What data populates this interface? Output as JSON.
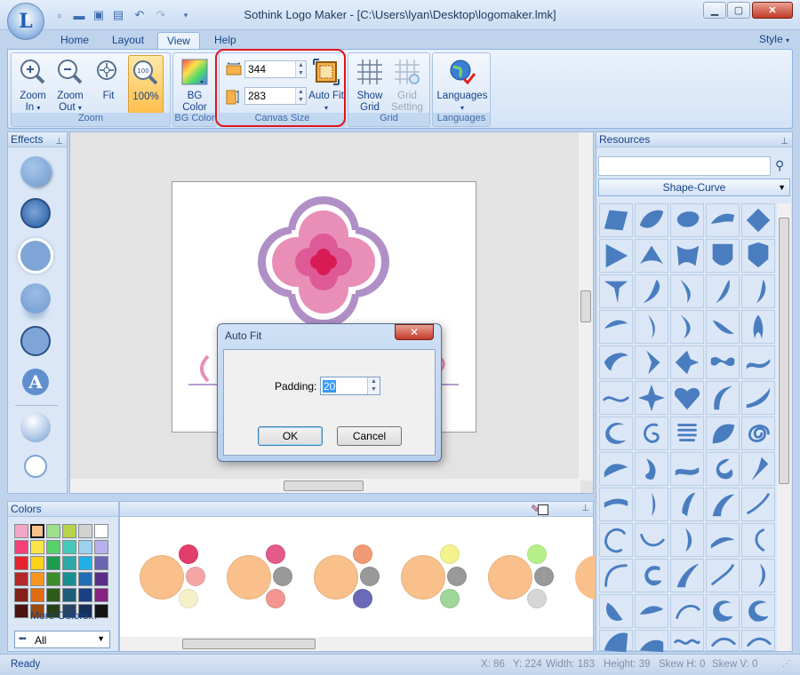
{
  "window": {
    "title": "Sothink Logo Maker - [C:\\Users\\lyan\\Desktop\\logomaker.lmk]"
  },
  "tabs": [
    {
      "label": "Home"
    },
    {
      "label": "Layout"
    },
    {
      "label": "View"
    },
    {
      "label": "Help"
    }
  ],
  "style_label": "Style",
  "ribbon": {
    "zoom_in": "Zoom In",
    "zoom_out": "Zoom Out",
    "fit": "Fit",
    "zoom_100": "100%",
    "bg_color": "BG Color",
    "auto_fit": "Auto Fit",
    "show_grid": "Show Grid",
    "grid_setting": "Grid Setting",
    "languages": "Languages",
    "canvas_width": "344",
    "canvas_height": "283",
    "groups": {
      "zoom": "Zoom",
      "bg_color": "BG Color",
      "canvas_size": "Canvas Size",
      "grid": "Grid",
      "languages": "Languages"
    }
  },
  "panels": {
    "effects": "Effects",
    "resources": "Resources",
    "colors": "Colors"
  },
  "resources": {
    "search_placeholder": "",
    "category": "Shape-Curve"
  },
  "colors": {
    "more": "More Colors...",
    "filter": "All",
    "swatches": [
      "#f4a6c6",
      "#f7c28e",
      "#9ce08a",
      "#b6d44a",
      "#d2d2d2",
      "#ffffff",
      "#f43f78",
      "#fbe44a",
      "#57d16a",
      "#48c8b8",
      "#9cd2ef",
      "#b8b0ec",
      "#e6232e",
      "#fdd21b",
      "#1f9b4e",
      "#2ca8a6",
      "#1fb0e8",
      "#6864b0",
      "#b6272a",
      "#f79520",
      "#3f8c2b",
      "#188f92",
      "#1f6eb5",
      "#5a2e88",
      "#842018",
      "#e26a11",
      "#2e5c1a",
      "#1d5d7a",
      "#193f84",
      "#852480",
      "#4a1210",
      "#9a4a12",
      "#27401a",
      "#274462",
      "#15305c",
      "#141414"
    ],
    "groups": [
      {
        "main": "#f9c08b",
        "a": "#e23d6b",
        "b": "#f4a6a6",
        "c": "#f5f0c8"
      },
      {
        "main": "#f9c08b",
        "a": "#e25b8a",
        "b": "#999999",
        "c": "#f2968f"
      },
      {
        "main": "#f9c08b",
        "a": "#f09a75",
        "b": "#999999",
        "c": "#6a6ab8"
      },
      {
        "main": "#f9c08b",
        "a": "#f3f28d",
        "b": "#999999",
        "c": "#9fd69a"
      },
      {
        "main": "#f9c08b",
        "a": "#b7f08a",
        "b": "#999999",
        "c": "#d6d6d6"
      }
    ]
  },
  "dialog": {
    "title": "Auto Fit",
    "padding_label": "Padding:",
    "padding_value": "20",
    "ok": "OK",
    "cancel": "Cancel"
  },
  "status": {
    "ready": "Ready",
    "x": "X: 86",
    "y": "Y: 224",
    "width": "Width: 183",
    "height": "Height: 39",
    "skew_h": "Skew H: 0",
    "skew_v": "Skew V: 0"
  },
  "accent": "#4a7dc0"
}
